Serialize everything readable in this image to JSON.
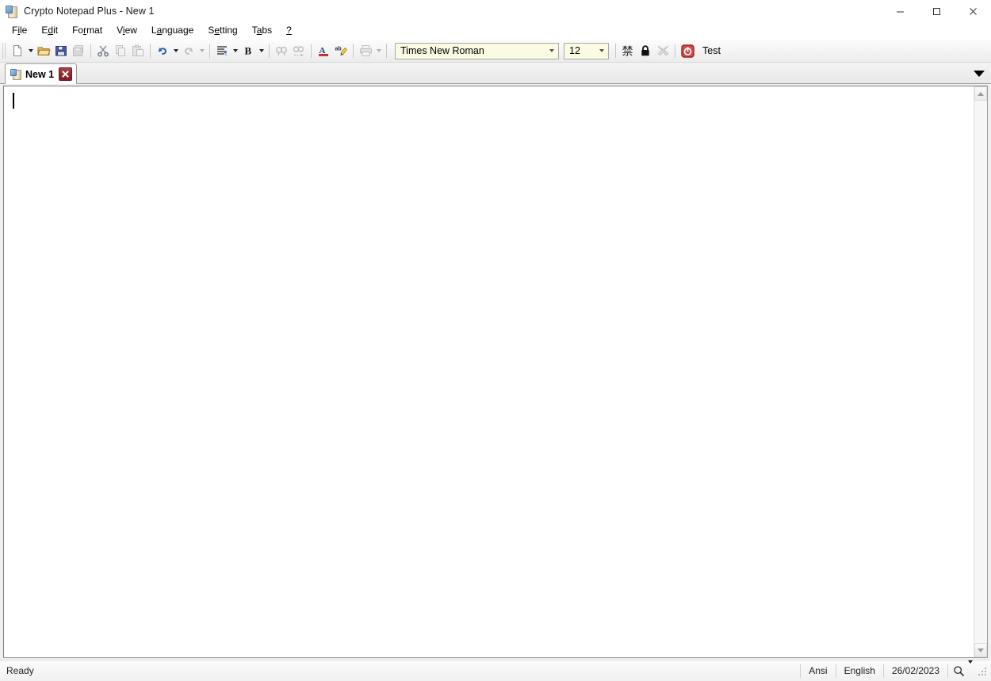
{
  "window": {
    "title": "Crypto Notepad Plus - New 1",
    "app_icon": "notepad-icon",
    "controls": {
      "minimize": "minimize-icon",
      "maximize": "maximize-icon",
      "close": "close-icon"
    }
  },
  "menubar": {
    "items": [
      {
        "label": "File",
        "pre": "F",
        "acc": "i",
        "post": "le"
      },
      {
        "label": "Edit",
        "pre": "E",
        "acc": "d",
        "post": "it"
      },
      {
        "label": "Format",
        "pre": "Fo",
        "acc": "r",
        "post": "mat"
      },
      {
        "label": "View",
        "pre": "V",
        "acc": "i",
        "post": "ew"
      },
      {
        "label": "Language",
        "pre": "L",
        "acc": "a",
        "post": "nguage"
      },
      {
        "label": "Setting",
        "pre": "S",
        "acc": "e",
        "post": "tting"
      },
      {
        "label": "Tabs",
        "pre": "T",
        "acc": "a",
        "post": "bs"
      },
      {
        "label": "?",
        "pre": "",
        "acc": "?",
        "post": ""
      }
    ]
  },
  "toolbar": {
    "buttons": [
      {
        "name": "new-document-icon",
        "title": "New",
        "enabled": true,
        "dropdown": true
      },
      {
        "name": "open-folder-icon",
        "title": "Open",
        "enabled": true,
        "dropdown": false
      },
      {
        "name": "save-icon",
        "title": "Save",
        "enabled": true,
        "dropdown": false
      },
      {
        "name": "save-all-icon",
        "title": "Save All",
        "enabled": false,
        "dropdown": false
      },
      {
        "name": "cut-icon",
        "title": "Cut",
        "enabled": true,
        "dropdown": false
      },
      {
        "name": "copy-icon",
        "title": "Copy",
        "enabled": false,
        "dropdown": false
      },
      {
        "name": "paste-icon",
        "title": "Paste",
        "enabled": false,
        "dropdown": false
      },
      {
        "name": "undo-icon",
        "title": "Undo",
        "enabled": true,
        "dropdown": true
      },
      {
        "name": "redo-icon",
        "title": "Redo",
        "enabled": false,
        "dropdown": true
      },
      {
        "name": "align-icon",
        "title": "Align",
        "enabled": true,
        "dropdown": true
      },
      {
        "name": "bold-icon",
        "title": "Bold",
        "enabled": true,
        "dropdown": true
      },
      {
        "name": "find-icon",
        "title": "Find",
        "enabled": false,
        "dropdown": false
      },
      {
        "name": "find-replace-icon",
        "title": "Replace",
        "enabled": false,
        "dropdown": false
      },
      {
        "name": "font-color-icon",
        "title": "Font Color",
        "enabled": true,
        "dropdown": false
      },
      {
        "name": "highlight-icon",
        "title": "Highlight",
        "enabled": true,
        "dropdown": false
      },
      {
        "name": "print-icon",
        "title": "Print",
        "enabled": false,
        "dropdown": true
      },
      {
        "name": "cjk-encode-icon",
        "title": "Encoding",
        "enabled": true,
        "dropdown": false
      },
      {
        "name": "lock-icon",
        "title": "Lock",
        "enabled": true,
        "dropdown": false
      },
      {
        "name": "tools-icon",
        "title": "Tools",
        "enabled": false,
        "dropdown": false
      },
      {
        "name": "power-icon",
        "title": "Exit",
        "enabled": true,
        "dropdown": false
      }
    ],
    "font_name": "Times New Roman",
    "font_size": "12",
    "test_label": "Test"
  },
  "tabs": {
    "items": [
      {
        "label": "New 1",
        "icon": "document-icon",
        "close": "close-tab-icon",
        "active": true
      }
    ],
    "list_button": "tab-list-icon"
  },
  "editor": {
    "content": "",
    "scrollbar": {
      "up": "scroll-up-icon",
      "down": "scroll-down-icon"
    }
  },
  "statusbar": {
    "message": "Ready",
    "encoding": "Ansi",
    "language": "English",
    "date": "26/02/2023",
    "zoom_icon": "magnifier-icon",
    "resize_grip": "resize-grip-icon"
  },
  "colors": {
    "accent_red": "#8e2a33",
    "combo_bg": "#fbfbe4",
    "window_bg": "#f0f0f0",
    "editor_bg": "#ffffff"
  }
}
